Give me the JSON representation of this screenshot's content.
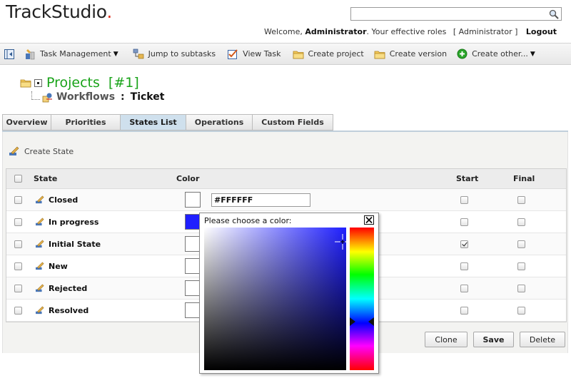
{
  "app": {
    "logo_text": "TrackStudio",
    "logo_dot": "."
  },
  "search": {
    "placeholder": "",
    "value": ""
  },
  "user": {
    "welcome_prefix": "Welcome,",
    "name": "Administrator",
    "roles_prefix": ". Your effective roles",
    "roles": "[ Administrator ]",
    "logout": "Logout"
  },
  "toolbar": {
    "items": [
      {
        "label": "Task Management",
        "icon": "tools-icon",
        "dropdown": true
      },
      {
        "label": "Jump to subtasks",
        "icon": "subtasks-icon",
        "dropdown": false
      },
      {
        "label": "View Task",
        "icon": "checklist-icon",
        "dropdown": false
      },
      {
        "label": "Create project",
        "icon": "folder-icon",
        "dropdown": false
      },
      {
        "label": "Create version",
        "icon": "folder-icon",
        "dropdown": false
      },
      {
        "label": "Create other...",
        "icon": "plus-circle-icon",
        "dropdown": true
      }
    ]
  },
  "breadcrumb": {
    "project": "Projects",
    "project_num": "[#1]",
    "workflows": "Workflows",
    "separator": ":",
    "current": "Ticket"
  },
  "tabs": [
    {
      "label": "Overview",
      "active": false
    },
    {
      "label": "Priorities",
      "active": false
    },
    {
      "label": "States List",
      "active": true
    },
    {
      "label": "Operations",
      "active": false
    },
    {
      "label": "Custom Fields",
      "active": false
    }
  ],
  "actions": {
    "create_state": "Create State"
  },
  "table": {
    "headers": {
      "state": "State",
      "color": "Color",
      "start": "Start",
      "final": "Final"
    },
    "rows": [
      {
        "name": "Closed",
        "color": "#FFFFFF",
        "color_text": "#FFFFFF",
        "start": false,
        "final": false
      },
      {
        "name": "In progress",
        "color": "#1F1FFF",
        "color_text": "",
        "start": false,
        "final": false
      },
      {
        "name": "Initial State",
        "color": "#FFFFFF",
        "color_text": "",
        "start": true,
        "final": false
      },
      {
        "name": "New",
        "color": "#FFFFFF",
        "color_text": "",
        "start": false,
        "final": false
      },
      {
        "name": "Rejected",
        "color": "#FFFFFF",
        "color_text": "",
        "start": false,
        "final": false
      },
      {
        "name": "Resolved",
        "color": "#FFFFFF",
        "color_text": "",
        "start": false,
        "final": false
      }
    ]
  },
  "buttons": {
    "clone": "Clone",
    "save": "Save",
    "delete": "Delete"
  },
  "color_picker": {
    "title": "Please choose a color:",
    "current_hue": "#1F1FFF"
  },
  "colors": {
    "project_green": "#19A319",
    "active_tab": "#CFE0ED",
    "logo_dot": "#E0301E"
  }
}
